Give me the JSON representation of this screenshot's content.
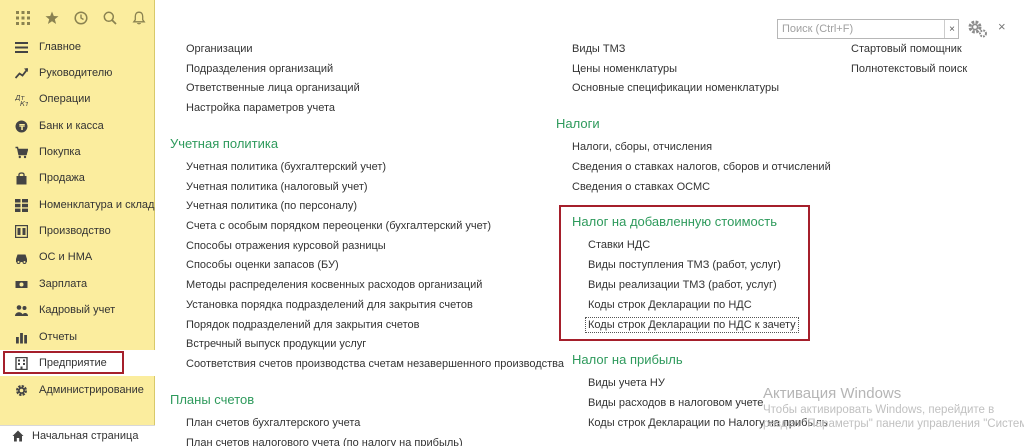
{
  "topbar": {
    "icons": [
      "apps-grid-icon",
      "star-icon",
      "history-icon",
      "search-icon",
      "bell-icon"
    ]
  },
  "sidebar": {
    "items": [
      {
        "label": "Главное",
        "icon": "menu-lines-icon"
      },
      {
        "label": "Руководителю",
        "icon": "chart-up-icon"
      },
      {
        "label": "Операции",
        "icon": "operations-icon"
      },
      {
        "label": "Банк и касса",
        "icon": "coin-icon"
      },
      {
        "label": "Покупка",
        "icon": "cart-icon"
      },
      {
        "label": "Продажа",
        "icon": "bag-icon"
      },
      {
        "label": "Номенклатура и склад",
        "icon": "grid-blocks-icon"
      },
      {
        "label": "Производство",
        "icon": "factory-icon"
      },
      {
        "label": "ОС и НМА",
        "icon": "car-icon"
      },
      {
        "label": "Зарплата",
        "icon": "money-icon"
      },
      {
        "label": "Кадровый учет",
        "icon": "people-icon"
      },
      {
        "label": "Отчеты",
        "icon": "bar-chart-icon"
      },
      {
        "label": "Предприятие",
        "icon": "building-icon"
      },
      {
        "label": "Администрирование",
        "icon": "gear-icon"
      }
    ],
    "home": "Начальная страница"
  },
  "search": {
    "placeholder": "Поиск (Ctrl+F)",
    "value": "",
    "clear": "×"
  },
  "close_symbol": "×",
  "col1": {
    "links_top": [
      "Организации",
      "Подразделения организаций",
      "Ответственные лица организаций",
      "Настройка параметров учета"
    ],
    "section_policy": {
      "title": "Учетная политика",
      "links": [
        "Учетная политика (бухгалтерский учет)",
        "Учетная политика (налоговый учет)",
        "Учетная политика (по персоналу)",
        "Счета с особым порядком переоценки (бухгалтерский учет)",
        "Способы отражения курсовой разницы",
        "Способы оценки запасов (БУ)",
        "Методы распределения косвенных расходов организаций",
        "Установка порядка подразделений для закрытия счетов",
        "Порядок подразделений для закрытия счетов",
        "Встречный выпуск продукции услуг",
        "Соответствия счетов производства счетам незавершенного производства"
      ]
    },
    "section_accounts": {
      "title": "Планы счетов",
      "links": [
        "План счетов бухгалтерского учета",
        "План счетов налогового учета (по налогу на прибыль)"
      ]
    }
  },
  "col2": {
    "links_top": [
      "Виды ТМЗ",
      "Цены номенклатуры",
      "Основные спецификации номенклатуры"
    ],
    "section_taxes": {
      "title": "Налоги",
      "links": [
        "Налоги, сборы, отчисления",
        "Сведения о ставках налогов, сборов и отчислений",
        "Сведения о ставках ОСМС"
      ]
    },
    "section_vat": {
      "title": "Налог на добавленную стоимость",
      "links": [
        "Ставки НДС",
        "Виды поступления ТМЗ (работ, услуг)",
        "Виды реализации ТМЗ (работ, услуг)",
        "Коды строк Декларации по НДС",
        "Коды строк Декларации по НДС к зачету"
      ]
    },
    "section_profit": {
      "title": "Налог на прибыль",
      "links": [
        "Виды учета НУ",
        "Виды расходов в налоговом учете",
        "Коды строк Декларации по Налогу на прибыль"
      ]
    }
  },
  "col3": {
    "links": [
      "Стартовый помощник",
      "Полнотекстовый поиск"
    ]
  },
  "watermark": {
    "title": "Активация Windows",
    "line1": "Чтобы активировать Windows, перейдите в",
    "line2": "раздел \"Параметры\" панели управления \"Система\"."
  },
  "colors": {
    "sidebar_bg": "#fbed9e",
    "section_title": "#2e9a5c",
    "highlight_border": "#a51f2b"
  }
}
